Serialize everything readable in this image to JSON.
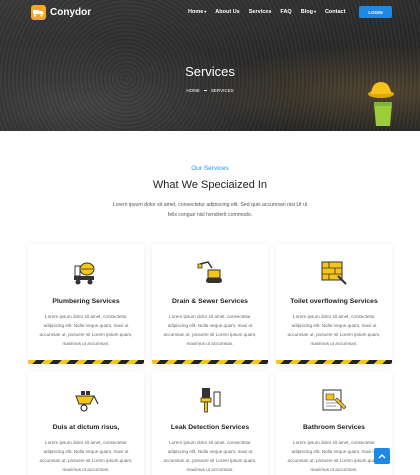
{
  "header": {
    "brand": "Conydor",
    "nav": [
      {
        "label": "Home",
        "dropdown": true
      },
      {
        "label": "About Us",
        "dropdown": false
      },
      {
        "label": "Services",
        "dropdown": false
      },
      {
        "label": "FAQ",
        "dropdown": false
      },
      {
        "label": "Blog",
        "dropdown": true
      },
      {
        "label": "Contact",
        "dropdown": false
      }
    ],
    "login_label": "LOGIN"
  },
  "hero": {
    "title": "Services",
    "breadcrumb": [
      "HOME",
      "SERVICES"
    ]
  },
  "intro": {
    "eyebrow": "Our Services",
    "title": "What We Speciaized In",
    "description": "Lorem ipsum dolor sit amet, consectetur adipiscing elit. Sed quis accumsan nisi Ut ut felis congue nisl hendrerit commodo."
  },
  "services": [
    {
      "title": "Plumbering Services",
      "icon": "cement-mixer-icon",
      "text": "Lorem ipsum dolor sit amet, consectetur adipiscing elit. Nulla neque quam, maxi ut accumsan ut, posuere sit Lorem ipsum quam, maximus ut accumsan."
    },
    {
      "title": "Drain & Sewer Services",
      "icon": "excavator-icon",
      "text": "Lorem ipsum dolor sit amet, consectetur adipiscing elit. Nulla neque quam, maxi ut accumsan ut, posuere sit Lorem ipsum quam, maximus ut accumsan."
    },
    {
      "title": "Toilet overflowing Services",
      "icon": "brick-wall-icon",
      "text": "Lorem ipsum dolor sit amet, consectetur adipiscing elit. Nulla neque quam, maxi ut accumsan ut, posuere sit Lorem ipsum quam, maximus ut accumsan."
    },
    {
      "title": "Duis at dictum risus,",
      "icon": "wheelbarrow-icon",
      "text": "Lorem ipsum dolor sit amet, consectetur adipiscing elit. Nulla neque quam, maxi ut accumsan ut, posuere sit Lorem ipsum quam, maximus ut accumsan."
    },
    {
      "title": "Leak Detection Services",
      "icon": "paint-brush-icon",
      "text": "Lorem ipsum dolor sit amet, consectetur adipiscing elit. Nulla neque quam, maxi ut accumsan ut, posuere sit Lorem ipsum quam, maximus ut accumsan."
    },
    {
      "title": "Bathroom Services",
      "icon": "blueprint-icon",
      "text": "Lorem ipsum dolor sit amet, consectetur adipiscing elit. Nulla neque quam, maxi ut accumsan ut, posuere sit Lorem ipsum quam, maximus ut accumsan."
    }
  ],
  "colors": {
    "accent": "#1e88e5",
    "brand": "#f5a623",
    "hazard": "#f5c518"
  }
}
